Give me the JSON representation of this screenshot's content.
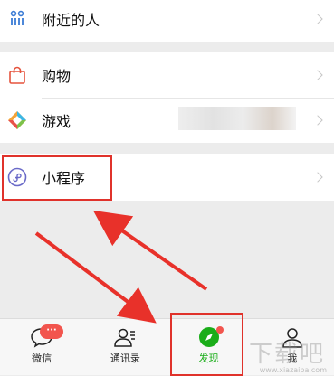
{
  "menu": {
    "nearby": "附近的人",
    "shopping": "购物",
    "games": "游戏",
    "mini_programs": "小程序"
  },
  "tabbar": {
    "chats": "微信",
    "chats_badge": "···",
    "contacts": "通讯录",
    "discover": "发现",
    "me": "我"
  },
  "watermark": {
    "text": "下载吧",
    "url": "www.xiazaiba.com"
  },
  "colors": {
    "accent_green": "#1aad19",
    "annotation_red": "#e0322b",
    "badge_red": "#f2554e"
  },
  "icons": [
    "people-nearby-icon",
    "shopping-bag-icon",
    "games-icon",
    "mini-program-icon",
    "chats-icon",
    "contacts-icon",
    "discover-icon",
    "me-icon"
  ]
}
